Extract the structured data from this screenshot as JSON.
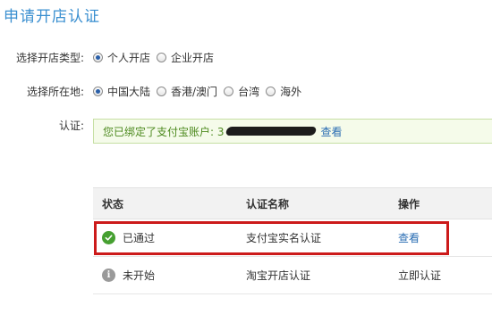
{
  "page": {
    "title": "申请开店认证"
  },
  "shop_type": {
    "label": "选择开店类型:",
    "options": [
      "个人开店",
      "企业开店"
    ],
    "selected": "个人开店"
  },
  "region": {
    "label": "选择所在地:",
    "options": [
      "中国大陆",
      "香港/澳门",
      "台湾",
      "海外"
    ],
    "selected": "中国大陆"
  },
  "auth": {
    "label": "认证:",
    "notice_prefix": "您已绑定了支付宝账户: 3",
    "view_link": "查看"
  },
  "table": {
    "headers": [
      "状态",
      "认证名称",
      "操作"
    ],
    "rows": [
      {
        "status": "已通过",
        "status_icon": "check-circle-icon",
        "name": "支付宝实名认证",
        "action": "查看"
      },
      {
        "status": "未开始",
        "status_icon": "info-circle-icon",
        "name": "淘宝开店认证",
        "action": "立即认证"
      }
    ]
  },
  "colors": {
    "title": "#3a8fd0",
    "success": "#46a031",
    "link": "#2a6db3",
    "highlight": "#cc1a1a",
    "notice_bg": "#f5fbea",
    "notice_text": "#4d8a1f"
  }
}
